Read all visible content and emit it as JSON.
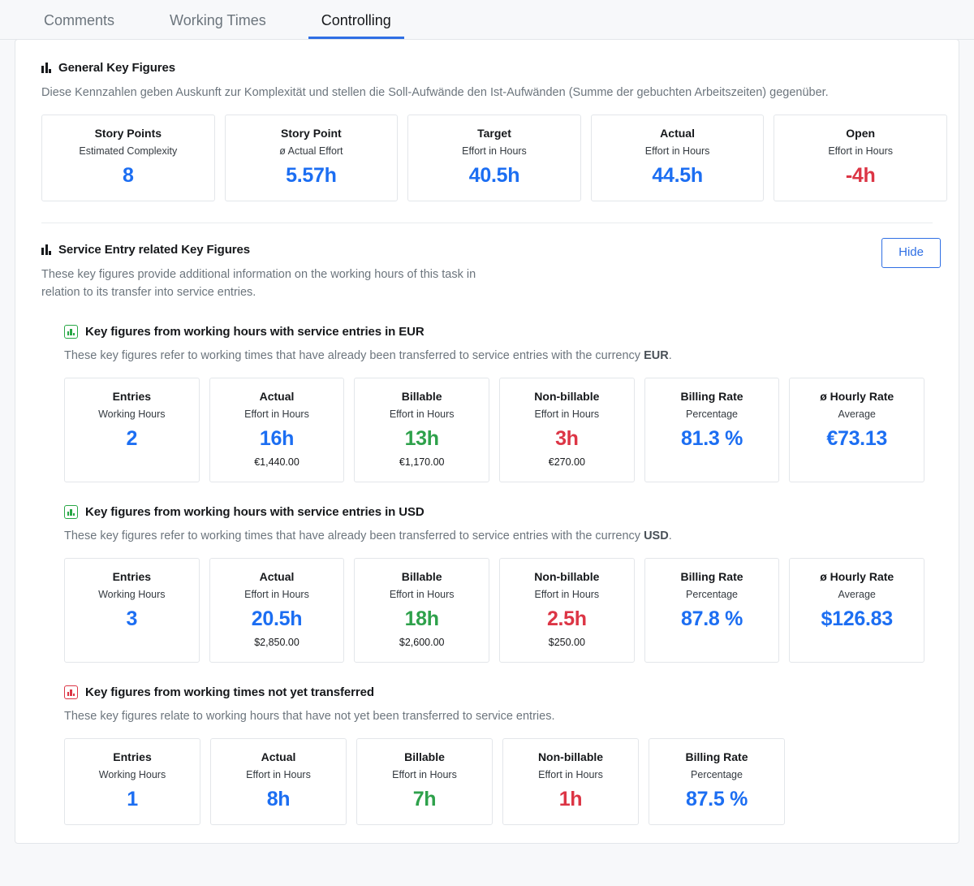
{
  "tabs": [
    {
      "label": "Comments",
      "active": false
    },
    {
      "label": "Working Times",
      "active": false
    },
    {
      "label": "Controlling",
      "active": true
    }
  ],
  "general": {
    "icon": "bar-chart-icon",
    "title": "General Key Figures",
    "description": "Diese Kennzahlen geben Auskunft zur Komplexität und stellen die Soll-Aufwände den Ist-Aufwänden (Summe der gebuchten Arbeitszeiten) gegenüber.",
    "cards": [
      {
        "title": "Story Points",
        "subtitle": "Estimated Complexity",
        "value": "8",
        "color": "blue",
        "money": ""
      },
      {
        "title": "Story Point",
        "subtitle": "ø Actual Effort",
        "value": "5.57h",
        "color": "blue",
        "money": ""
      },
      {
        "title": "Target",
        "subtitle": "Effort in Hours",
        "value": "40.5h",
        "color": "blue",
        "money": ""
      },
      {
        "title": "Actual",
        "subtitle": "Effort in Hours",
        "value": "44.5h",
        "color": "blue",
        "money": ""
      },
      {
        "title": "Open",
        "subtitle": "Effort in Hours",
        "value": "-4h",
        "color": "red",
        "money": ""
      }
    ]
  },
  "service": {
    "icon": "bar-chart-icon",
    "title": "Service Entry related Key Figures",
    "description_line1": "These key figures provide additional information on the working hours of this task in",
    "description_line2": "relation to its transfer into service entries.",
    "hide_label": "Hide",
    "accent_color": "#2f6fe4"
  },
  "eur": {
    "icon": "chart-box-green-icon",
    "title": "Key figures from working hours with service entries in EUR",
    "description_prefix": "These key figures refer to working times that have already been transferred to service entries with the currency ",
    "description_strong": "EUR",
    "description_suffix": ".",
    "cards": [
      {
        "title": "Entries",
        "subtitle": "Working Hours",
        "value": "2",
        "color": "blue",
        "money": ""
      },
      {
        "title": "Actual",
        "subtitle": "Effort in Hours",
        "value": "16h",
        "color": "blue",
        "money": "€1,440.00"
      },
      {
        "title": "Billable",
        "subtitle": "Effort in Hours",
        "value": "13h",
        "color": "green",
        "money": "€1,170.00"
      },
      {
        "title": "Non-billable",
        "subtitle": "Effort in Hours",
        "value": "3h",
        "color": "red",
        "money": "€270.00"
      },
      {
        "title": "Billing Rate",
        "subtitle": "Percentage",
        "value": "81.3 %",
        "color": "blue",
        "money": ""
      },
      {
        "title": "ø Hourly Rate",
        "subtitle": "Average",
        "value": "€73.13",
        "color": "blue",
        "money": ""
      }
    ]
  },
  "usd": {
    "icon": "chart-box-green-icon",
    "title": "Key figures from working hours with service entries in USD",
    "description_prefix": "These key figures refer to working times that have already been transferred to service entries with the currency ",
    "description_strong": "USD",
    "description_suffix": ".",
    "cards": [
      {
        "title": "Entries",
        "subtitle": "Working Hours",
        "value": "3",
        "color": "blue",
        "money": ""
      },
      {
        "title": "Actual",
        "subtitle": "Effort in Hours",
        "value": "20.5h",
        "color": "blue",
        "money": "$2,850.00"
      },
      {
        "title": "Billable",
        "subtitle": "Effort in Hours",
        "value": "18h",
        "color": "green",
        "money": "$2,600.00"
      },
      {
        "title": "Non-billable",
        "subtitle": "Effort in Hours",
        "value": "2.5h",
        "color": "red",
        "money": "$250.00"
      },
      {
        "title": "Billing Rate",
        "subtitle": "Percentage",
        "value": "87.8 %",
        "color": "blue",
        "money": ""
      },
      {
        "title": "ø Hourly Rate",
        "subtitle": "Average",
        "value": "$126.83",
        "color": "blue",
        "money": ""
      }
    ]
  },
  "untransferred": {
    "icon": "chart-box-red-icon",
    "title": "Key figures from working times not yet transferred",
    "description": "These key figures relate to working hours that have not yet been transferred to service entries.",
    "cards": [
      {
        "title": "Entries",
        "subtitle": "Working Hours",
        "value": "1",
        "color": "blue",
        "money": ""
      },
      {
        "title": "Actual",
        "subtitle": "Effort in Hours",
        "value": "8h",
        "color": "blue",
        "money": ""
      },
      {
        "title": "Billable",
        "subtitle": "Effort in Hours",
        "value": "7h",
        "color": "green",
        "money": ""
      },
      {
        "title": "Non-billable",
        "subtitle": "Effort in Hours",
        "value": "1h",
        "color": "red",
        "money": ""
      },
      {
        "title": "Billing Rate",
        "subtitle": "Percentage",
        "value": "87.5 %",
        "color": "blue",
        "money": ""
      }
    ]
  }
}
